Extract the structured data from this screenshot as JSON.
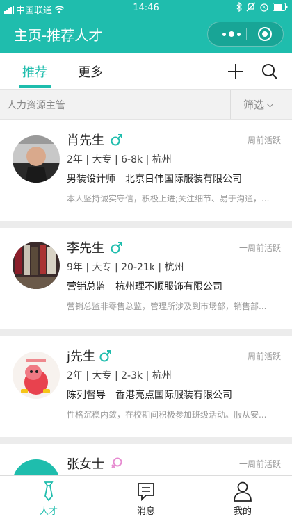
{
  "status_bar": {
    "carrier": "中国联通",
    "time": "14:46"
  },
  "header": {
    "title": "主页-推荐人才"
  },
  "tabs": {
    "recommend": "推荐",
    "more": "更多"
  },
  "search": {
    "query": "人力资源主管",
    "filter_label": "筛选"
  },
  "colors": {
    "accent": "#1fbdad",
    "male": "#1fbdad",
    "female": "#e68bd0"
  },
  "candidates": [
    {
      "name": "肖先生",
      "gender": "male",
      "active": "一周前活跃",
      "meta": "2年 | 大专 | 6-8k | 杭州",
      "job": "男装设计师",
      "company": "北京日伟国际服装有限公司",
      "desc": "本人坚持诚实守信，积极上进;关注细节、易于沟通，..."
    },
    {
      "name": "李先生",
      "gender": "male",
      "active": "一周前活跃",
      "meta": "9年 | 大专 | 20-21k | 杭州",
      "job": "营销总监",
      "company": "杭州理不顺服饰有限公司",
      "desc": "营销总监非零售总监，管理所涉及到市场部，销售部..."
    },
    {
      "name": "j先生",
      "gender": "male",
      "active": "一周前活跃",
      "meta": "2年 | 大专 | 2-3k | 杭州",
      "job": "陈列督导",
      "company": "香港亮点国际服装有限公司",
      "desc": "性格沉稳内敛，在校期间积极参加班级活动。服从安..."
    },
    {
      "name": "张女士",
      "gender": "female",
      "active": "一周前活跃"
    }
  ],
  "tabbar": {
    "talent": "人才",
    "messages": "消息",
    "mine": "我的"
  }
}
